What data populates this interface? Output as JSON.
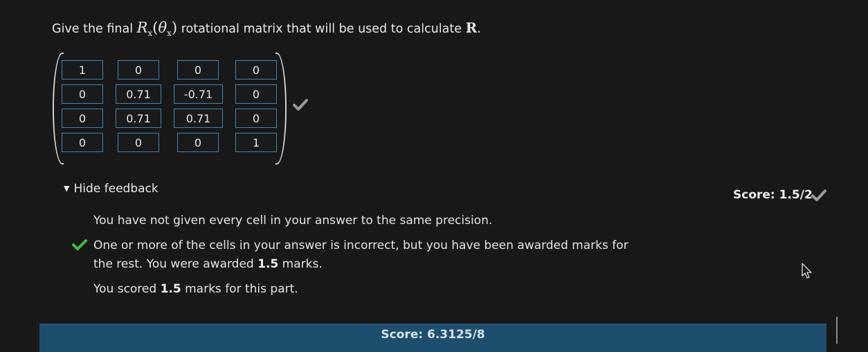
{
  "question": {
    "prefix": "Give the final",
    "math_symbol": "R",
    "math_sub": "x",
    "math_arg": "θ",
    "math_arg_sub": "x",
    "suffix": "rotational matrix that will be used to calculate",
    "bold_symbol": "R",
    "end": "."
  },
  "matrix": {
    "rows": [
      [
        "1",
        "0",
        "0",
        "0"
      ],
      [
        "0",
        "0.71",
        "-0.71",
        "0"
      ],
      [
        "0",
        "0.71",
        "0.71",
        "0"
      ],
      [
        "0",
        "0",
        "0",
        "1"
      ]
    ]
  },
  "feedback": {
    "toggle_label": "Hide feedback",
    "precision_msg": "You have not given every cell in your answer to the same precision.",
    "partial_msg_1": "One or more of the cells in your answer is incorrect, but you have been awarded marks for",
    "partial_msg_2a": "the rest. You were awarded",
    "partial_marks": "1.5",
    "partial_msg_2b": "marks.",
    "scored_a": "You scored",
    "scored_marks": "1.5",
    "scored_b": "marks for this part."
  },
  "part_score": {
    "label": "Score: 1.5/2"
  },
  "total_score": {
    "label": "Score: 6.3125/8"
  },
  "icons": {
    "tick_gray": "check-icon",
    "tick_green": "check-icon",
    "cursor": "mouse-pointer-icon"
  },
  "colors": {
    "background": "#181818",
    "cell_border": "#3a87b3",
    "green": "#3fbf3f",
    "total_bar": "#1d4e6e"
  }
}
